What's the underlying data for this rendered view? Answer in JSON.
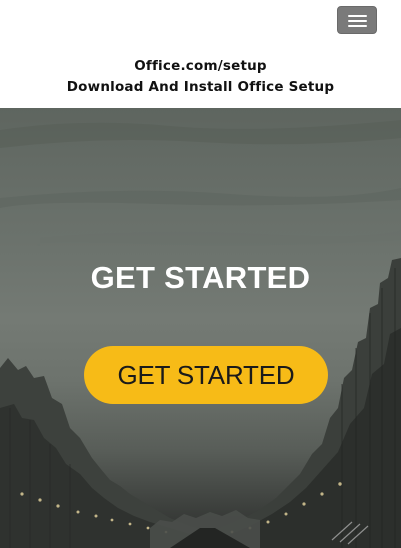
{
  "header": {
    "menu_icon": "hamburger-menu-icon",
    "title_line1": "Office.com/setup",
    "title_line2": "Download And Install Office Setup"
  },
  "hero": {
    "heading": "GET STARTED",
    "button_label": "GET STARTED",
    "button_color": "#f7bb17",
    "background_description_colors": [
      "#5e655f",
      "#747a74",
      "#2a2c2a"
    ]
  }
}
